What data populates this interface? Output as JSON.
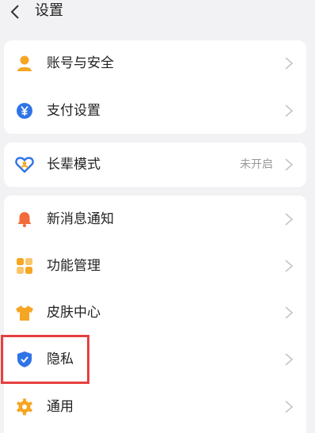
{
  "header": {
    "title": "设置",
    "back_icon": "chevron-left-icon"
  },
  "groups": [
    {
      "items": [
        {
          "label": "账号与安全",
          "icon": "user-icon",
          "icon_color": "#f5a623"
        },
        {
          "label": "支付设置",
          "icon": "yuan-icon",
          "icon_color": "#2f73e8"
        }
      ]
    },
    {
      "items": [
        {
          "label": "长辈模式",
          "icon": "heart-people-icon",
          "icon_color": "#2f73e8",
          "value": "未开启"
        }
      ]
    },
    {
      "items": [
        {
          "label": "新消息通知",
          "icon": "bell-icon",
          "icon_color": "#f26b3a"
        },
        {
          "label": "功能管理",
          "icon": "grid-icon",
          "icon_color": "#f5a623"
        },
        {
          "label": "皮肤中心",
          "icon": "tshirt-icon",
          "icon_color": "#f5a623"
        },
        {
          "label": "隐私",
          "icon": "shield-check-icon",
          "icon_color": "#2f73e8",
          "highlighted": true
        },
        {
          "label": "通用",
          "icon": "gear-icon",
          "icon_color": "#f5a623"
        }
      ]
    }
  ],
  "colors": {
    "background": "#f2f2f4",
    "card": "#ffffff",
    "highlight": "#e6403f",
    "chevron": "#c4c4c4"
  }
}
